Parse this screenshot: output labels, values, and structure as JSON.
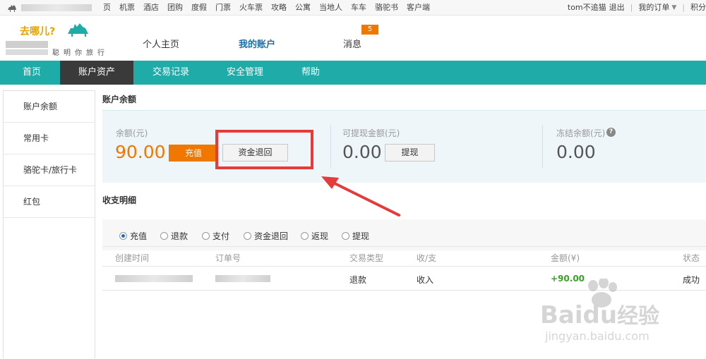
{
  "topbar": {
    "nav": [
      "页",
      "机票",
      "酒店",
      "团购",
      "度假",
      "门票",
      "火车票",
      "攻略",
      "公寓",
      "当地人",
      "车车",
      "骆驼书",
      "客户端"
    ],
    "user": "tom不追猫",
    "logout": "退出",
    "my_orders": "我的订单",
    "points": "积分"
  },
  "logo": {
    "text": "去哪儿?",
    "sub": "聪明你旅行"
  },
  "main_nav": {
    "home": "个人主页",
    "account": "我的账户",
    "messages": "消息",
    "messages_badge": "5"
  },
  "tabs": [
    "首页",
    "账户资产",
    "交易记录",
    "安全管理",
    "帮助"
  ],
  "sidebar": [
    "账户余额",
    "常用卡",
    "骆驼卡/旅行卡",
    "红包"
  ],
  "balance": {
    "title": "账户余额",
    "balance_label": "余额(元)",
    "balance_value": "90.00",
    "recharge_btn": "充值",
    "refund_btn": "资金退回",
    "withdrawable_label": "可提现金额(元)",
    "withdrawable_value": "0.00",
    "withdraw_btn": "提现",
    "frozen_label": "冻结余额(元)",
    "frozen_value": "0.00",
    "help_icon": "?"
  },
  "details": {
    "title": "收支明细",
    "filters": [
      "充值",
      "退款",
      "支付",
      "资金退回",
      "返现",
      "提现"
    ],
    "selected_filter": "充值",
    "columns": [
      "创建时间",
      "订单号",
      "交易类型",
      "收/支",
      "金额(¥)",
      "状态"
    ],
    "rows": [
      {
        "type": "退款",
        "direction": "收入",
        "amount": "+90.00",
        "status": "成功"
      }
    ]
  },
  "watermark": {
    "brand_left": "Bai",
    "brand_right": "du",
    "brand_cn": "经验",
    "url": "jingyan.baidu.com"
  },
  "colors": {
    "accent": "#1faca8",
    "orange": "#f07800",
    "annotation": "#e53b3b",
    "amount_green": "#3aa02b"
  }
}
